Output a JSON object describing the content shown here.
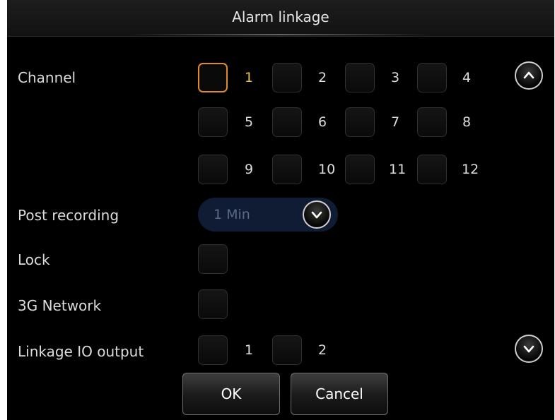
{
  "dialog": {
    "title": "Alarm linkage"
  },
  "channel": {
    "label": "Channel",
    "items": [
      {
        "label": "1",
        "checked": false,
        "focused": true
      },
      {
        "label": "2",
        "checked": false
      },
      {
        "label": "3",
        "checked": false
      },
      {
        "label": "4",
        "checked": false
      },
      {
        "label": "5",
        "checked": false
      },
      {
        "label": "6",
        "checked": false
      },
      {
        "label": "7",
        "checked": false
      },
      {
        "label": "8",
        "checked": false
      },
      {
        "label": "9",
        "checked": false
      },
      {
        "label": "10",
        "checked": false
      },
      {
        "label": "11",
        "checked": false
      },
      {
        "label": "12",
        "checked": false
      }
    ]
  },
  "post_recording": {
    "label": "Post recording",
    "value": "1 Min"
  },
  "lock": {
    "label": "Lock",
    "checked": false
  },
  "network": {
    "label": "3G Network",
    "checked": false
  },
  "linkage_io": {
    "label": "Linkage IO output",
    "items": [
      {
        "label": "1",
        "checked": false
      },
      {
        "label": "2",
        "checked": false
      }
    ]
  },
  "buttons": {
    "ok": "OK",
    "cancel": "Cancel"
  },
  "icons": {
    "scroll_up": "chevron-up-icon",
    "scroll_down": "chevron-down-icon",
    "dropdown": "chevron-down-icon"
  },
  "colors": {
    "focus": "#e08a2a",
    "active_number": "#e2c23c",
    "select_bg": "#0f1c33"
  }
}
